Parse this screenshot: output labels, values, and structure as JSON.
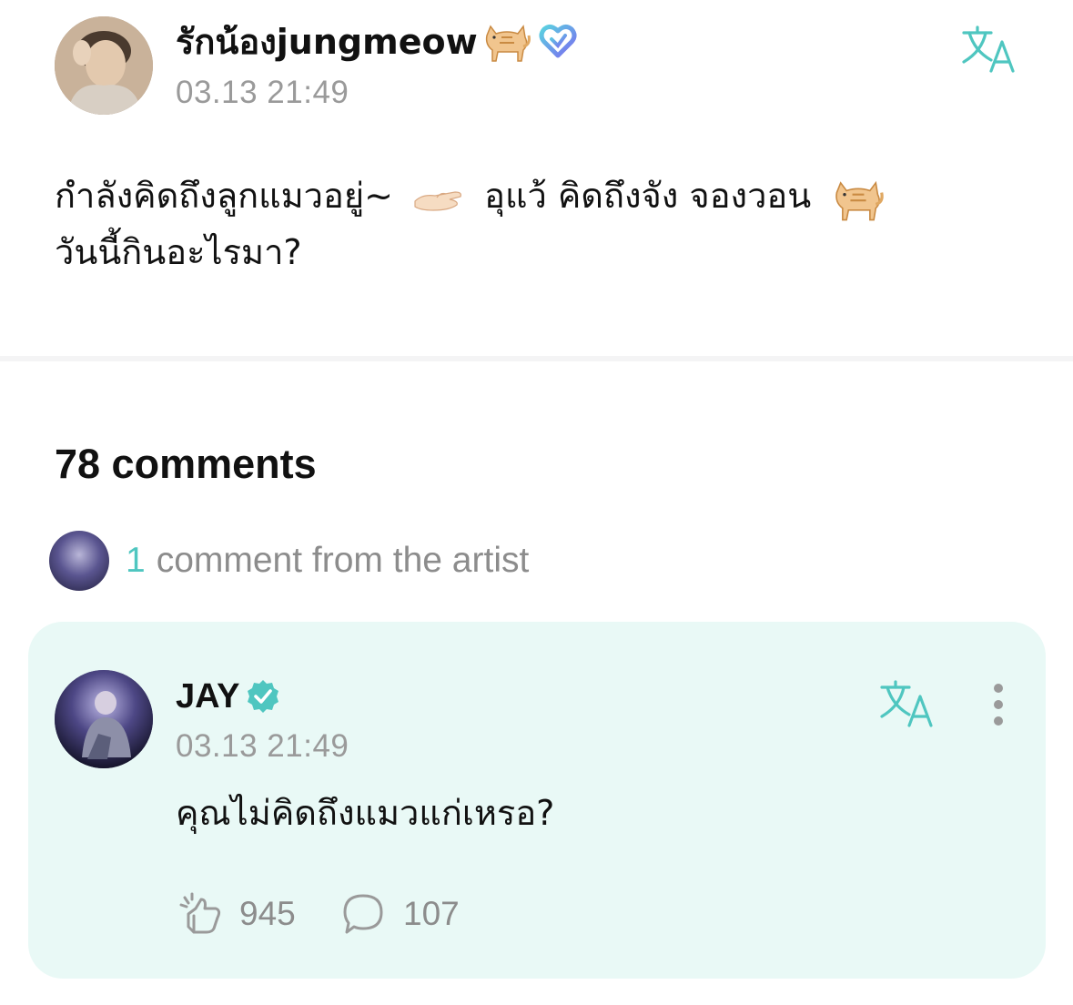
{
  "post": {
    "author": "รักน้องjungmeow",
    "timestamp": "03.13 21:49",
    "body_line1_a": "กำลังคิดถึงลูกแมวอยู่~",
    "body_line1_b": "อุแว้ คิดถึงจัง จองวอน",
    "body_line2": "วันนี้กินอะไรมา?",
    "icons": [
      "cat-emoji",
      "heart-badge-icon",
      "translate-icon",
      "palm-up-hand-emoji"
    ]
  },
  "comments": {
    "count_label": "78 comments",
    "artist_summary": {
      "count": "1",
      "label": "comment from the artist"
    }
  },
  "artist_comment": {
    "author": "JAY",
    "timestamp": "03.13 21:49",
    "text": "คุณไม่คิดถึงแมวแก่เหรอ?",
    "likes": "945",
    "replies": "107",
    "icons": [
      "verified-badge-icon",
      "translate-icon",
      "more-options-icon",
      "like-icon",
      "reply-icon"
    ]
  },
  "colors": {
    "accent": "#4fc6c0",
    "card_background": "#e9f9f6",
    "muted_text": "#9a9a9a",
    "primary_text": "#111111"
  }
}
